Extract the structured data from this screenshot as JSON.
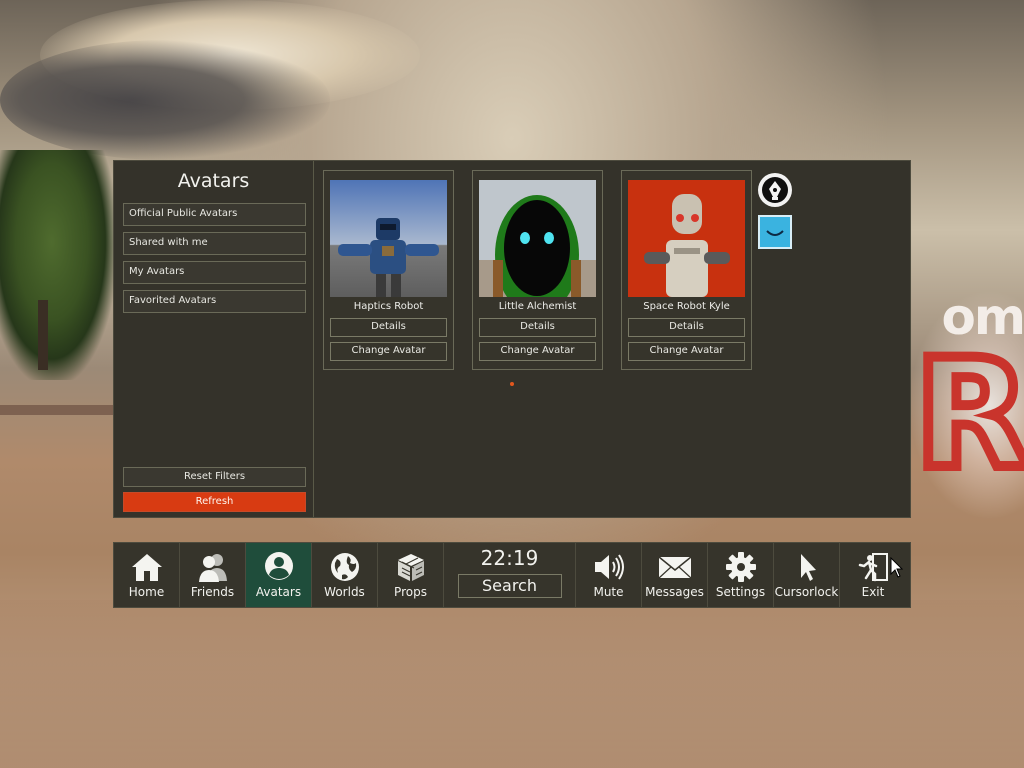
{
  "sidebar": {
    "title": "Avatars",
    "filters": [
      {
        "label": "Official Public Avatars"
      },
      {
        "label": "Shared with me"
      },
      {
        "label": "My Avatars"
      },
      {
        "label": "Favorited Avatars"
      }
    ],
    "reset_label": "Reset Filters",
    "refresh_label": "Refresh"
  },
  "avatars": [
    {
      "name": "Haptics Robot",
      "details_label": "Details",
      "change_label": "Change Avatar"
    },
    {
      "name": "Little Alchemist",
      "details_label": "Details",
      "change_label": "Change Avatar"
    },
    {
      "name": "Space Robot Kyle",
      "details_label": "Details",
      "change_label": "Change Avatar"
    }
  ],
  "side_icons": [
    "pen-nib-icon",
    "smile-icon"
  ],
  "navbar": {
    "items_left": [
      {
        "label": "Home",
        "icon": "home-icon"
      },
      {
        "label": "Friends",
        "icon": "friends-icon"
      },
      {
        "label": "Avatars",
        "icon": "avatar-icon",
        "active": true
      },
      {
        "label": "Worlds",
        "icon": "globe-icon"
      },
      {
        "label": "Props",
        "icon": "cube-icon"
      }
    ],
    "clock": "22:19",
    "search_label": "Search",
    "items_right": [
      {
        "label": "Mute",
        "icon": "speaker-icon"
      },
      {
        "label": "Messages",
        "icon": "envelope-icon"
      },
      {
        "label": "Settings",
        "icon": "gear-icon"
      },
      {
        "label": "Cursorlock",
        "icon": "cursor-icon"
      },
      {
        "label": "Exit",
        "icon": "exit-icon"
      }
    ]
  },
  "background_text": {
    "sign_word": "om",
    "sign_letter": "R"
  },
  "colors": {
    "accent": "#d83b12",
    "active_tab": "#1f4d3b",
    "panel": "#34322a",
    "page_dot": "#e2571d"
  }
}
